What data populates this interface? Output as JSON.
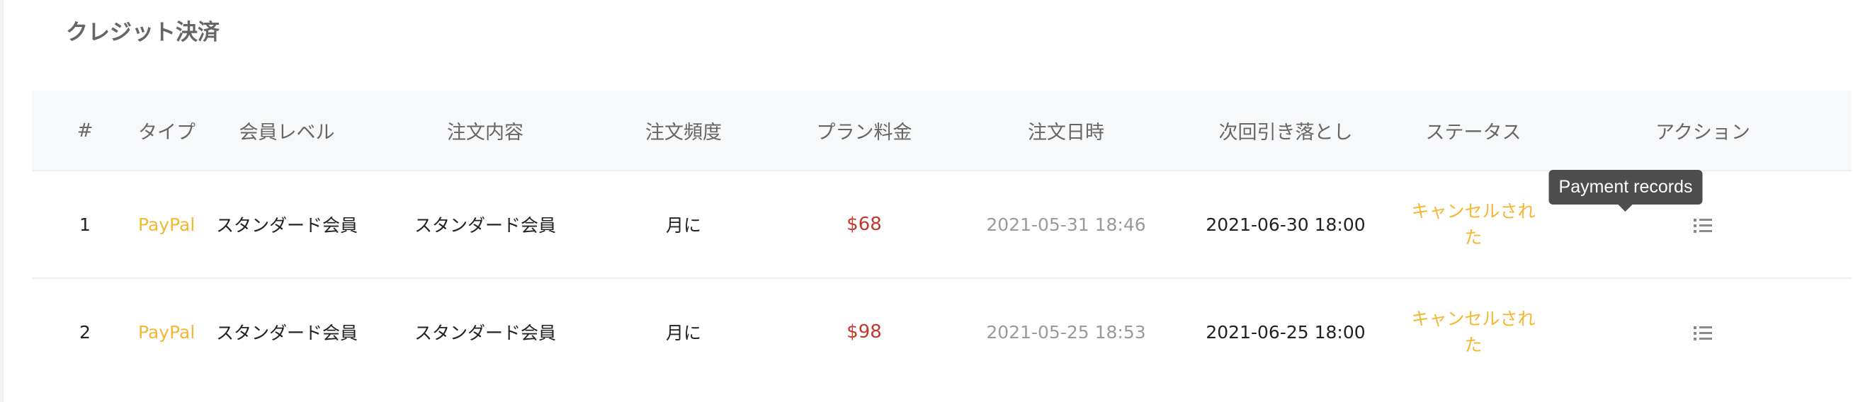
{
  "section": {
    "title": "クレジット決済"
  },
  "table": {
    "headers": {
      "index": "#",
      "type": "タイプ",
      "level": "会員レベル",
      "content": "注文内容",
      "frequency": "注文頻度",
      "price": "プラン料金",
      "order_date": "注文日時",
      "next_charge": "次回引き落とし",
      "status": "ステータス",
      "action": "アクション"
    },
    "rows": [
      {
        "index": "1",
        "type": "PayPal",
        "level": "スタンダード会員",
        "content": "スタンダード会員",
        "frequency": "月に",
        "price": "$68",
        "order_date": "2021-05-31 18:46",
        "next_charge": "2021-06-30 18:00",
        "status": "キャンセルされた"
      },
      {
        "index": "2",
        "type": "PayPal",
        "level": "スタンダード会員",
        "content": "スタンダード会員",
        "frequency": "月に",
        "price": "$98",
        "order_date": "2021-05-25 18:53",
        "next_charge": "2021-06-25 18:00",
        "status": "キャンセルされた"
      }
    ]
  },
  "tooltip": {
    "text": "Payment records"
  },
  "icons": {
    "action": "list-icon"
  },
  "colors": {
    "type_link": "#f5b731",
    "price": "#c0392b",
    "status": "#f5b731",
    "order_date": "#9a9a9a",
    "header_bg": "#f7f8fa",
    "tooltip_bg": "#4d4d4d"
  }
}
